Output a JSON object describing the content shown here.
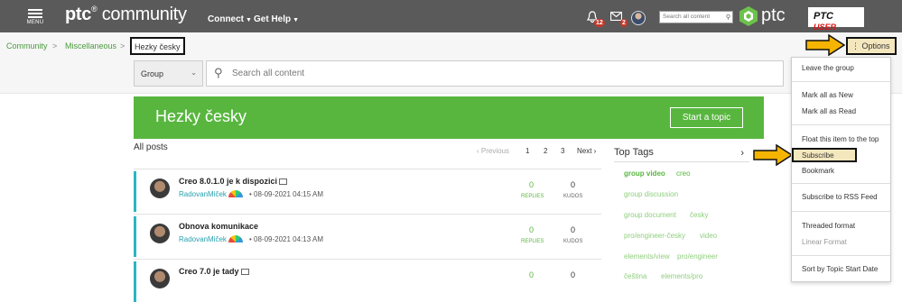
{
  "header": {
    "menu_label": "MENU",
    "logo_text": "ptc",
    "logo_suffix": "community",
    "nav": [
      "Connect",
      "Get Help"
    ],
    "notifications_count": "12",
    "messages_count": "2",
    "search_placeholder": "Search all content",
    "brand": "ptc",
    "ptc_user_text": "PTC",
    "ptc_user_script": "USER"
  },
  "breadcrumb": {
    "items": [
      "Community",
      "Miscellaneous",
      "Hezky česky"
    ],
    "separator": ">"
  },
  "options_label": "Options",
  "search": {
    "scope": "Group",
    "placeholder": "Search all content"
  },
  "banner": {
    "title": "Hezky česky",
    "start_topic": "Start a topic"
  },
  "posts": {
    "heading": "All posts",
    "pager": {
      "previous": "‹ Previous",
      "pages": [
        "1",
        "2",
        "3"
      ],
      "next": "Next ›"
    },
    "replies_label": "REPLIES",
    "kudos_label": "KUDOS",
    "items": [
      {
        "title": "Creo 8.0.1.0 je k dispozici",
        "author": "RadovanMiček",
        "date": "08-09-2021 04:15 AM",
        "replies": "0",
        "kudos": "0"
      },
      {
        "title": "Obnova komunikace",
        "author": "RadovanMiček",
        "date": "08-09-2021 04:13 AM",
        "replies": "0",
        "kudos": "0"
      },
      {
        "title": "Creo 7.0 je tady",
        "author": "",
        "date": "",
        "replies": "0",
        "kudos": "0"
      }
    ]
  },
  "top_tags": {
    "heading": "Top Tags",
    "tags": [
      "group video",
      "creo",
      "group discussion",
      "group document",
      "česky",
      "pro/engineer-česky",
      "video",
      "elements/view",
      "pro/engineer",
      "čeština",
      "elements/pro"
    ]
  },
  "options_menu": {
    "items": [
      "Leave the group",
      "Mark all as New",
      "Mark all as Read",
      "Float this item to the top",
      "Subscribe",
      "Bookmark",
      "Subscribe to RSS Feed",
      "Threaded format",
      "Linear Format",
      "Sort by Topic Start Date"
    ]
  },
  "colors": {
    "accent_green": "#58b63f",
    "topbar": "#5a5a5a",
    "highlight": "#f4e7be",
    "arrow": "#f5b400",
    "post_bar": "#29b6c2"
  }
}
